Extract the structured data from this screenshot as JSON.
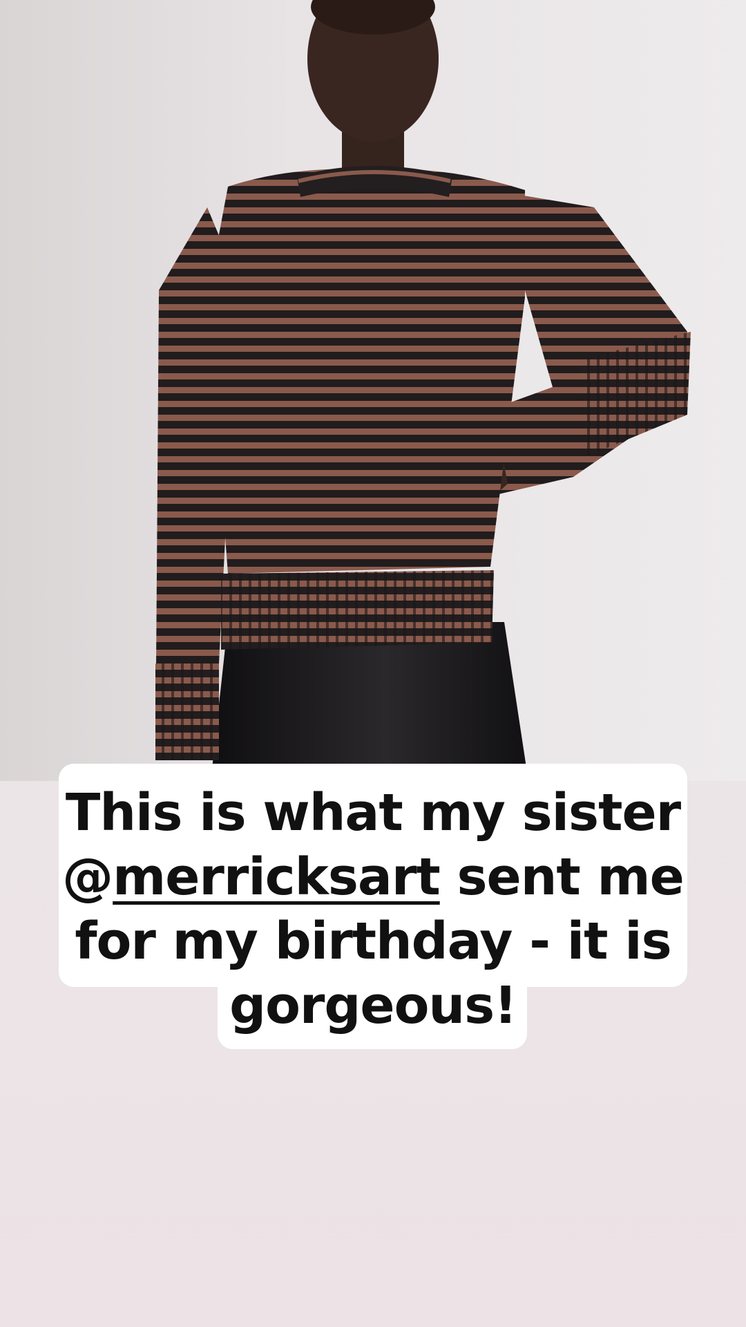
{
  "story": {
    "caption": {
      "line1": "This is what my sister",
      "mention_symbol": "@",
      "mention_handle": "merricksart",
      "after_mention": " sent me",
      "line3": "for my birthday - it is",
      "line4": "gorgeous!"
    },
    "photo": {
      "icon": "product-photo-striped-sweater"
    },
    "colors": {
      "sweater_stripe_light": "#8a5a4c",
      "sweater_stripe_dark": "#1e1a1b",
      "skirt": "#141315",
      "skin": "#3a2620",
      "caption_bg": "#ffffff",
      "caption_text": "#111111"
    }
  }
}
